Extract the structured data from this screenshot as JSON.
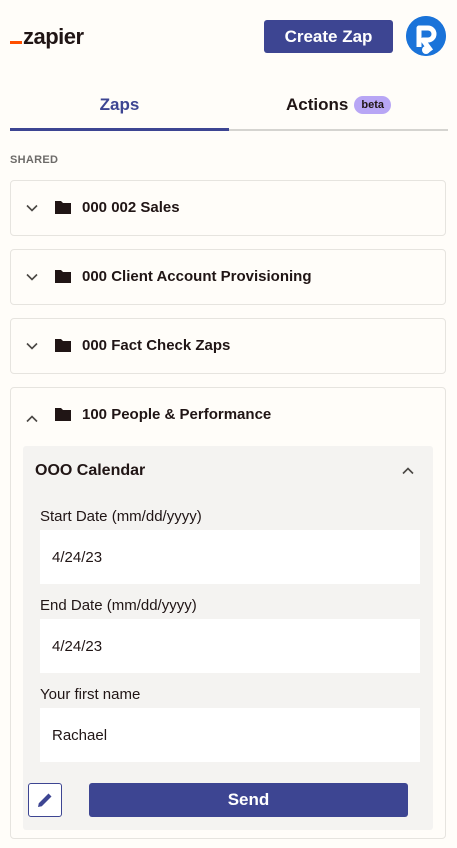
{
  "header": {
    "logo_text": "zapier",
    "create_button_label": "Create Zap",
    "brand_color": "#ff4f00",
    "accent_color": "#3d4592"
  },
  "tabs": [
    {
      "label": "Zaps",
      "active": true
    },
    {
      "label": "Actions",
      "badge": "beta",
      "active": false
    }
  ],
  "section_label": "SHARED",
  "folders": [
    {
      "name": "000 002 Sales",
      "expanded": false
    },
    {
      "name": "000 Client Account Provisioning",
      "expanded": false
    },
    {
      "name": "000 Fact Check Zaps",
      "expanded": false
    },
    {
      "name": "100 People & Performance",
      "expanded": true
    }
  ],
  "zap": {
    "title": "OOO Calendar",
    "fields": [
      {
        "label": "Start Date (mm/dd/yyyy)",
        "value": "4/24/23"
      },
      {
        "label": "End Date (mm/dd/yyyy)",
        "value": "4/24/23"
      },
      {
        "label": "Your first name",
        "value": "Rachael"
      }
    ],
    "send_label": "Send",
    "edit_icon": "pencil-icon"
  }
}
